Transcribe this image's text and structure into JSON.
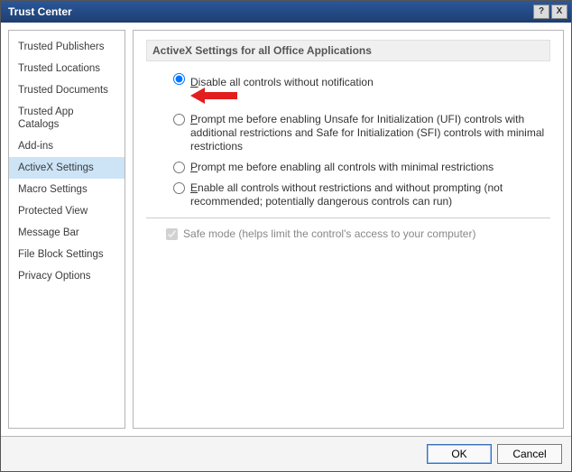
{
  "window": {
    "title": "Trust Center",
    "help_label": "?",
    "close_label": "X"
  },
  "sidebar": {
    "items": [
      {
        "label": "Trusted Publishers",
        "selected": false
      },
      {
        "label": "Trusted Locations",
        "selected": false
      },
      {
        "label": "Trusted Documents",
        "selected": false
      },
      {
        "label": "Trusted App Catalogs",
        "selected": false
      },
      {
        "label": "Add-ins",
        "selected": false
      },
      {
        "label": "ActiveX Settings",
        "selected": true
      },
      {
        "label": "Macro Settings",
        "selected": false
      },
      {
        "label": "Protected View",
        "selected": false
      },
      {
        "label": "Message Bar",
        "selected": false
      },
      {
        "label": "File Block Settings",
        "selected": false
      },
      {
        "label": "Privacy Options",
        "selected": false
      }
    ]
  },
  "section": {
    "header": "ActiveX Settings for all Office Applications",
    "options": [
      {
        "accel": "D",
        "rest": "isable all controls without notification",
        "selected": true,
        "arrow": true
      },
      {
        "accel": "P",
        "rest": "rompt me before enabling Unsafe for Initialization (UFI) controls with additional restrictions and Safe for Initialization (SFI) controls with minimal restrictions",
        "selected": false,
        "arrow": false
      },
      {
        "accel": "P",
        "rest": "rompt me before enabling all controls with minimal restrictions",
        "selected": false,
        "arrow": false
      },
      {
        "accel": "E",
        "rest": "nable all controls without restrictions and without prompting (not recommended; potentially dangerous controls can run)",
        "selected": false,
        "arrow": false
      }
    ],
    "safe_mode": {
      "accel": "S",
      "rest": "afe mode (helps limit the control's access to your computer)",
      "checked": true,
      "disabled": true
    }
  },
  "footer": {
    "ok": "OK",
    "cancel": "Cancel"
  }
}
